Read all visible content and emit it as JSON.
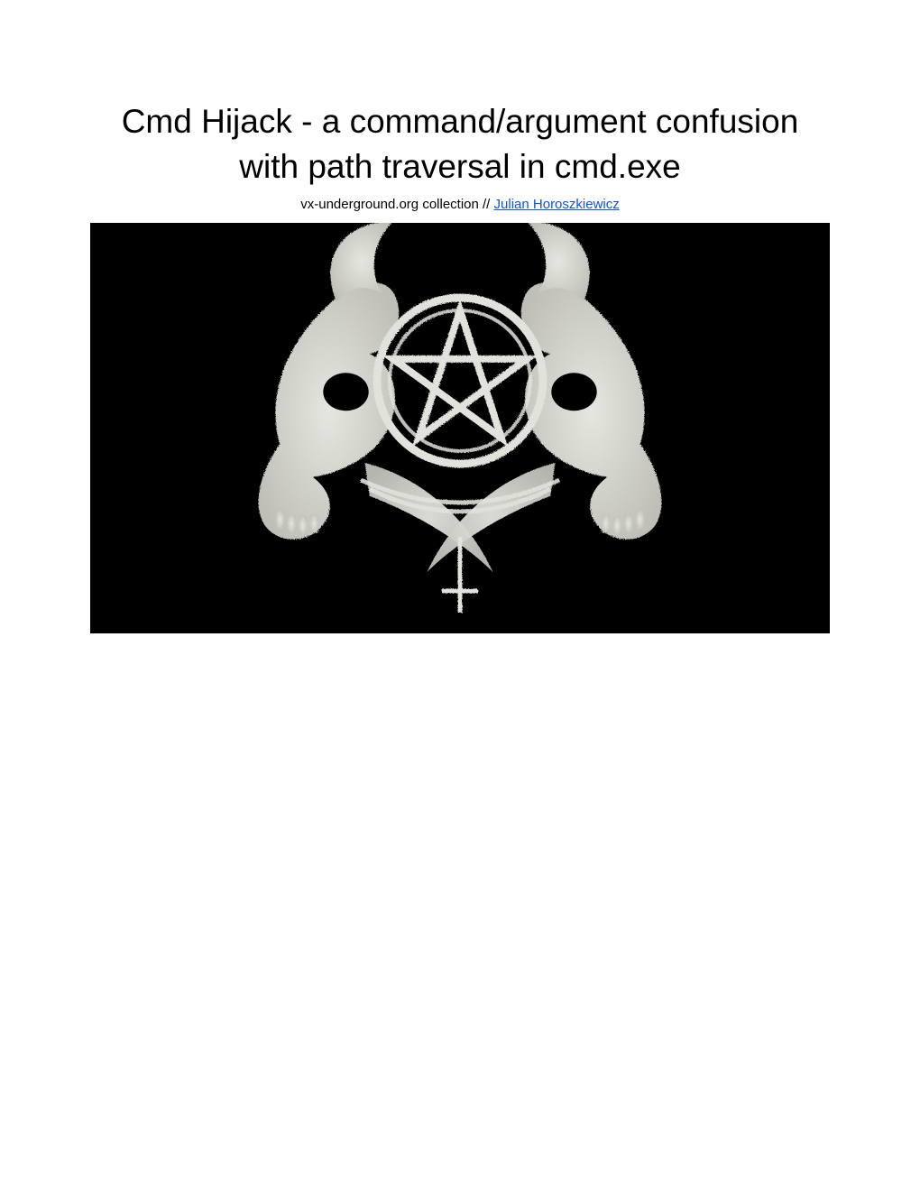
{
  "title": "Cmd Hijack - a command/argument confusion with path traversal in cmd.exe",
  "byline_prefix": "vx-underground.org collection // ",
  "author_link_text": "Julian Horoszkiewicz",
  "hero_image": {
    "semantic": "skulls-pentagram-cross-illustration",
    "background": "#000000",
    "foreground": "#d8d8d4"
  }
}
